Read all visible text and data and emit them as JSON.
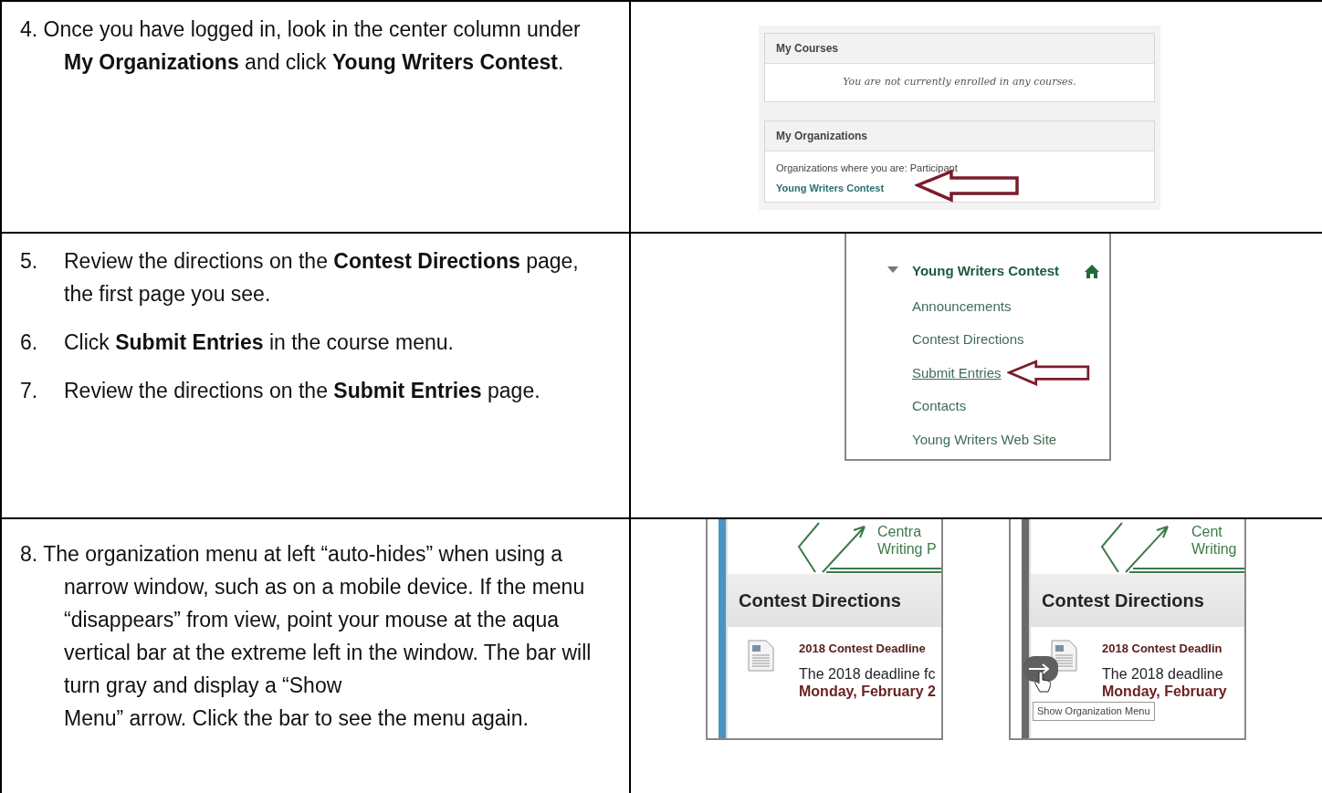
{
  "rows": [
    {
      "instructions": [
        {
          "kind": "inline",
          "text": "4. Once you have logged in, look in the center column under **My Organizations** and click **Young Writers Contest**."
        }
      ],
      "screenshots": [
        {
          "kind": "dashboard",
          "modules": [
            {
              "title": "My Courses",
              "message": "You are not currently enrolled in any courses."
            },
            {
              "title": "My Organizations",
              "role_line": "Organizations where you are: Participant",
              "link": "Young Writers Contest",
              "arrow": true
            }
          ]
        }
      ]
    },
    {
      "instructions": [
        {
          "kind": "tabbed",
          "number": "5.",
          "text": "Review the directions on the **Contest Directions** page, the first page you see."
        },
        {
          "kind": "tabbed",
          "number": "6.",
          "text": "Click **Submit Entries** in the course menu."
        },
        {
          "kind": "tabbed",
          "number": "7.",
          "text": "Review the directions on the **Submit Entries** page."
        }
      ],
      "screenshots": [
        {
          "kind": "course_menu",
          "title": "Young Writers Contest",
          "expanded": true,
          "items": [
            {
              "label": "Announcements",
              "hovered": false,
              "arrow": false
            },
            {
              "label": "Contest Directions",
              "hovered": false,
              "arrow": false
            },
            {
              "label": "Submit Entries",
              "hovered": true,
              "arrow": true
            },
            {
              "label": "Contacts",
              "hovered": false,
              "arrow": false
            },
            {
              "label": "Young Writers Web Site",
              "hovered": false,
              "arrow": false
            }
          ]
        }
      ]
    },
    {
      "instructions": [
        {
          "kind": "inline",
          "text": "8. The organization menu at left “auto-hides” when using a narrow window, such as on a mobile device. If the menu “disappears” from view, point your mouse at the aqua vertical bar at the extreme left in the window. The bar will turn gray and display a “Show\nMenu” arrow. Click the bar to see the menu again."
        }
      ],
      "screenshots": [
        {
          "kind": "content_page",
          "bar_hovered": false,
          "logo_lines": [
            "Centra",
            "Writing P"
          ],
          "heading": "Contest Directions",
          "item_title": "2018 Contest Deadline",
          "item_text": "The 2018 deadline fc",
          "item_date": "Monday, February 2"
        },
        {
          "kind": "content_page",
          "bar_hovered": true,
          "logo_lines": [
            "Cent",
            "Writing"
          ],
          "heading": "Contest Directions",
          "item_title": "2018 Contest Deadlin",
          "item_text": "The 2018 deadline",
          "item_date": "Monday, February",
          "tooltip": "Show Organization Menu"
        }
      ]
    }
  ]
}
